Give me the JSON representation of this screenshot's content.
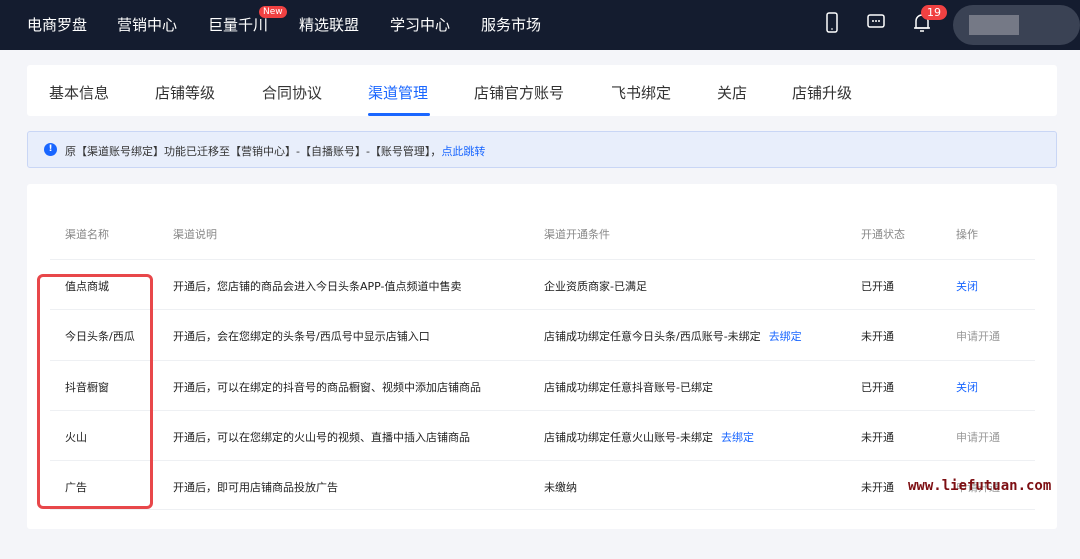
{
  "nav": {
    "items": [
      "电商罗盘",
      "营销中心",
      "巨量千川",
      "精选联盟",
      "学习中心",
      "服务市场"
    ],
    "new_badge": "New",
    "notification_count": "19"
  },
  "tabs": [
    "基本信息",
    "店铺等级",
    "合同协议",
    "渠道管理",
    "店铺官方账号",
    "飞书绑定",
    "关店",
    "店铺升级"
  ],
  "active_tab": "渠道管理",
  "alert": {
    "text": "原【渠道账号绑定】功能已迁移至【营销中心】-【自播账号】-【账号管理】，",
    "link": "点此跳转"
  },
  "table": {
    "headers": [
      "渠道名称",
      "渠道说明",
      "渠道开通条件",
      "开通状态",
      "操作"
    ],
    "rows": [
      {
        "name": "值点商城",
        "desc": "开通后，您店铺的商品会进入今日头条APP-值点频道中售卖",
        "cond": "企业资质商家-已满足",
        "cond_link": "",
        "status": "已开通",
        "action": "关闭",
        "action_active": true
      },
      {
        "name": "今日头条/西瓜",
        "desc": "开通后，会在您绑定的头条号/西瓜号中显示店铺入口",
        "cond": "店铺成功绑定任意今日头条/西瓜账号-未绑定",
        "cond_link": "去绑定",
        "status": "未开通",
        "action": "申请开通",
        "action_active": false
      },
      {
        "name": "抖音橱窗",
        "desc": "开通后，可以在绑定的抖音号的商品橱窗、视频中添加店铺商品",
        "cond": "店铺成功绑定任意抖音账号-已绑定",
        "cond_link": "",
        "status": "已开通",
        "action": "关闭",
        "action_active": true
      },
      {
        "name": "火山",
        "desc": "开通后，可以在您绑定的火山号的视频、直播中插入店铺商品",
        "cond": "店铺成功绑定任意火山账号-未绑定",
        "cond_link": "去绑定",
        "status": "未开通",
        "action": "申请开通",
        "action_active": false
      },
      {
        "name": "广告",
        "desc": "开通后，即可用店铺商品投放广告",
        "cond": "未缴纳",
        "cond_link": "",
        "status": "未开通",
        "action": "申请开通",
        "action_active": false
      }
    ]
  },
  "watermark": "www.liefutuan.com",
  "colors": {
    "nav_bg": "#141c2f",
    "accent": "#1966ff",
    "highlight_box": "#e8474a"
  }
}
